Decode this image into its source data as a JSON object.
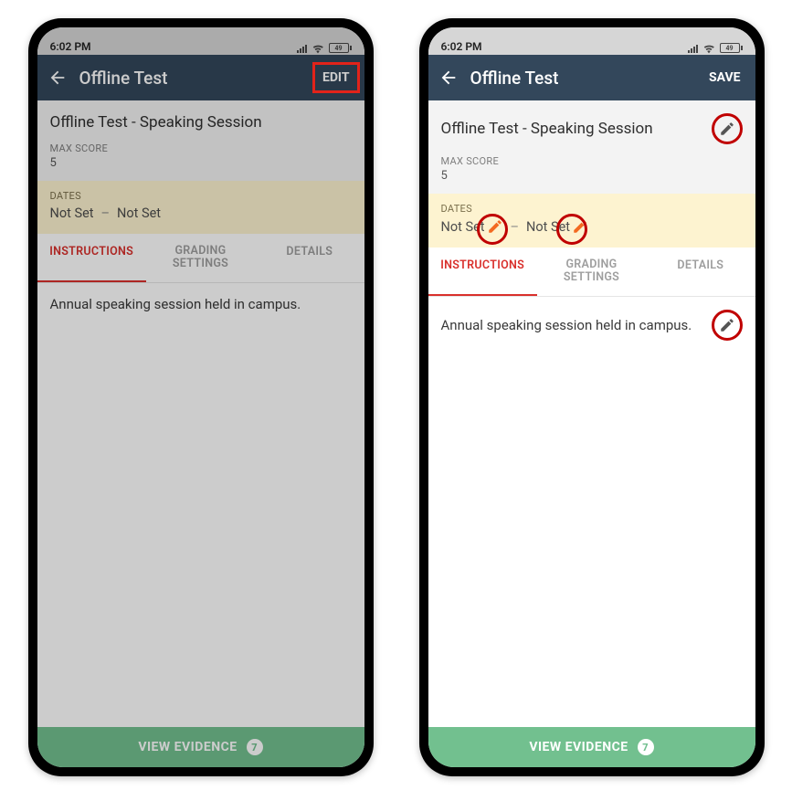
{
  "status": {
    "time": "6:02 PM",
    "battery": "49"
  },
  "left": {
    "appbar": {
      "title": "Offline Test",
      "action": "EDIT"
    },
    "header": {
      "title": "Offline Test - Speaking Session",
      "max_score_label": "MAX SCORE",
      "max_score_value": "5"
    },
    "dates": {
      "label": "DATES",
      "from": "Not Set",
      "to": "Not Set"
    },
    "tabs": {
      "instructions": "INSTRUCTIONS",
      "grading": "GRADING\nSETTINGS",
      "details": "DETAILS"
    },
    "content": "Annual speaking session held in campus.",
    "footer": {
      "label": "VIEW EVIDENCE",
      "count": "7"
    }
  },
  "right": {
    "appbar": {
      "title": "Offline Test",
      "action": "SAVE"
    },
    "header": {
      "title": "Offline Test - Speaking Session",
      "max_score_label": "MAX SCORE",
      "max_score_value": "5"
    },
    "dates": {
      "label": "DATES",
      "from": "Not Set",
      "to": "Not Set"
    },
    "tabs": {
      "instructions": "INSTRUCTIONS",
      "grading": "GRADING\nSETTINGS",
      "details": "DETAILS"
    },
    "content": "Annual speaking session held in campus.",
    "footer": {
      "label": "VIEW EVIDENCE",
      "count": "7"
    }
  }
}
